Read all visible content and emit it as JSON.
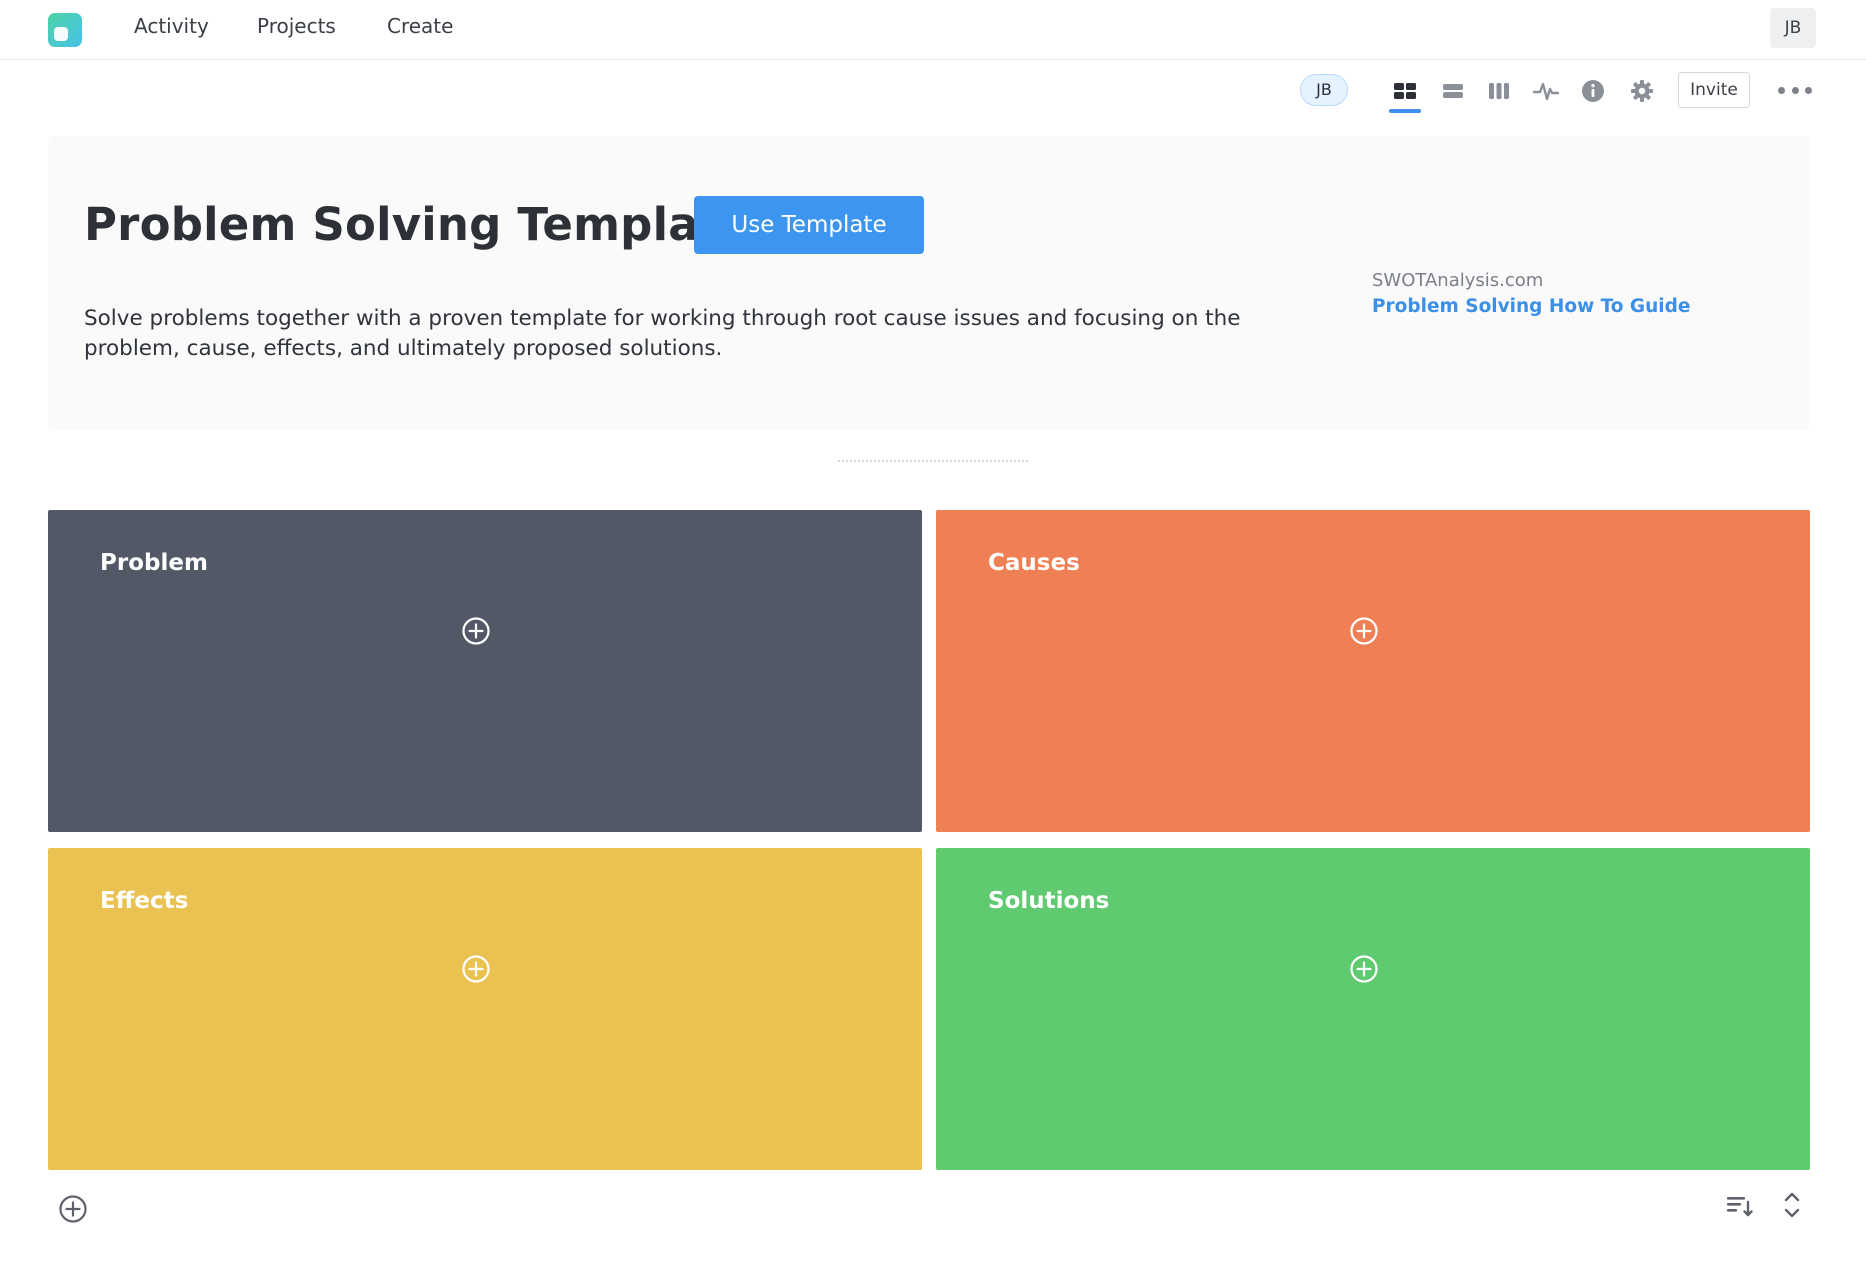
{
  "nav": {
    "links": [
      "Activity",
      "Projects",
      "Create"
    ],
    "user_initials": "JB"
  },
  "toolbar": {
    "member_initials": "JB",
    "view_icons": [
      "grid-view-icon",
      "list-view-icon",
      "columns-view-icon",
      "activity-icon",
      "info-icon",
      "gear-icon"
    ],
    "active_view": "grid-view-icon",
    "invite_label": "Invite",
    "more_icon": "more-horizontal-icon"
  },
  "header": {
    "title": "Problem Solving Template",
    "use_template_label": "Use Template",
    "description": "Solve problems together with a proven template for working through root cause issues and focusing on the problem, cause, effects, and ultimately proposed solutions.",
    "source": "SWOTAnalysis.com",
    "guide_link": "Problem Solving How To Guide"
  },
  "quadrants": [
    {
      "label": "Problem",
      "color": "#525866"
    },
    {
      "label": "Causes",
      "color": "#ef7f55"
    },
    {
      "label": "Effects",
      "color": "#eac252"
    },
    {
      "label": "Solutions",
      "color": "#60ca70"
    }
  ],
  "colors": {
    "accent": "#3c95ee",
    "link": "#3c8fe6"
  }
}
